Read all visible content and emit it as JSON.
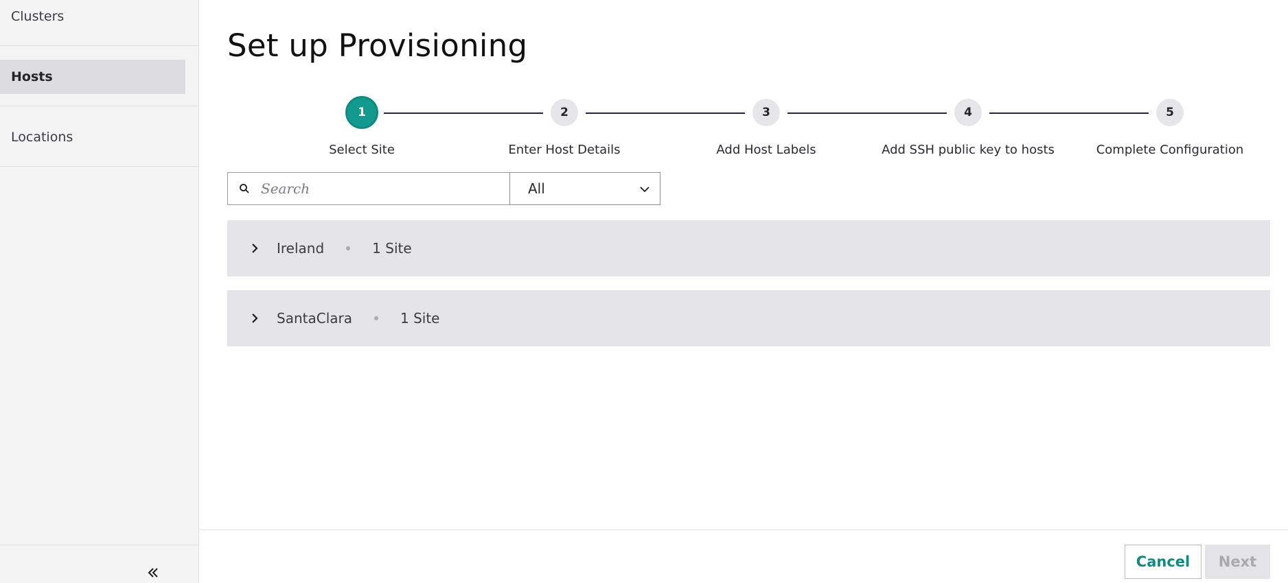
{
  "sidebar": {
    "items": [
      {
        "label": "Clusters"
      },
      {
        "label": "Hosts"
      },
      {
        "label": "Locations"
      }
    ],
    "collapse_icon": "double-chevron-left-icon"
  },
  "page": {
    "title": "Set up Provisioning"
  },
  "stepper": {
    "active_step": 1,
    "steps": [
      {
        "number": "1",
        "label": "Select Site"
      },
      {
        "number": "2",
        "label": "Enter Host Details"
      },
      {
        "number": "3",
        "label": "Add Host Labels"
      },
      {
        "number": "4",
        "label": "Add SSH public key to hosts"
      },
      {
        "number": "5",
        "label": "Complete Configuration"
      }
    ]
  },
  "filter": {
    "search_placeholder": "Search",
    "search_value": "",
    "select_value": "All"
  },
  "groups": [
    {
      "name": "Ireland",
      "count": "1 Site"
    },
    {
      "name": "SantaClara",
      "count": "1 Site"
    }
  ],
  "footer": {
    "cancel_label": "Cancel",
    "next_label": "Next"
  },
  "colors": {
    "accent": "#129a8f",
    "sidebar_bg": "#f4f4f5",
    "group_bg": "#e5e5e9"
  }
}
